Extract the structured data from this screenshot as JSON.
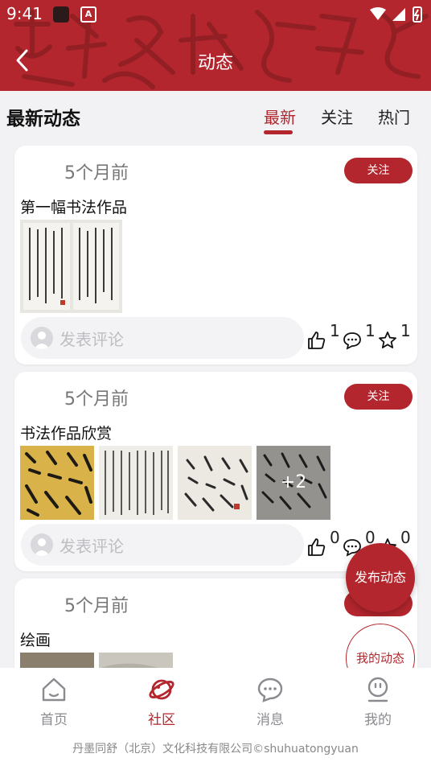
{
  "status_bar": {
    "time": "9:41",
    "app_badge": "A"
  },
  "header": {
    "title": "动态"
  },
  "section": {
    "title": "最新动态"
  },
  "tabs": [
    {
      "label": "最新",
      "active": true
    },
    {
      "label": "关注",
      "active": false
    },
    {
      "label": "热门",
      "active": false
    }
  ],
  "posts": [
    {
      "time": "5个月前",
      "follow_label": "关注",
      "title": "第一幅书法作品",
      "comment_placeholder": "发表评论",
      "likes": "1",
      "comments": "1",
      "favorites": "1"
    },
    {
      "time": "5个月前",
      "follow_label": "关注",
      "title": "书法作品欣赏",
      "more_count": "+2",
      "comment_placeholder": "发表评论",
      "likes": "0",
      "comments": "0",
      "favorites": "0"
    },
    {
      "time": "5个月前",
      "follow_label": "关注",
      "title": "绘画"
    }
  ],
  "fab": {
    "publish_label": "发布动态",
    "mine_label": "我的动态"
  },
  "bottom_nav": [
    {
      "label": "首页",
      "icon": "home-icon",
      "active": false
    },
    {
      "label": "社区",
      "icon": "planet-icon",
      "active": true
    },
    {
      "label": "消息",
      "icon": "chat-icon",
      "active": false
    },
    {
      "label": "我的",
      "icon": "user-icon",
      "active": false
    }
  ],
  "footer": {
    "copyright": "丹墨同舒（北京）文化科技有限公司©shuhuatongyuan"
  },
  "colors": {
    "brand": "#b3262d",
    "background": "#f2f2f4",
    "muted_text": "#8a8a90"
  }
}
